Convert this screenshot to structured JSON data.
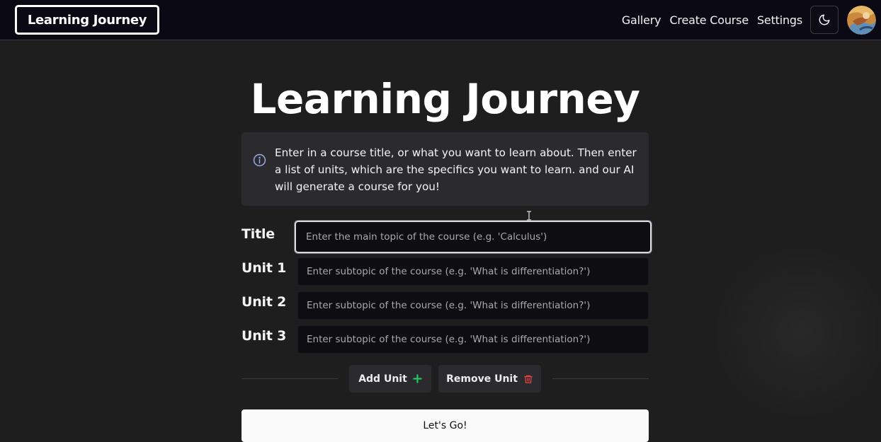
{
  "app": {
    "brand": "Learning Journey"
  },
  "nav": {
    "links": [
      "Gallery",
      "Create Course",
      "Settings"
    ],
    "theme_icon": "moon-icon",
    "avatar_icon": "user-avatar"
  },
  "main": {
    "title": "Learning Journey",
    "info": {
      "icon": "info-icon",
      "text": "Enter in a course title, or what you want to learn about. Then enter a list of units, which are the specifics you want to learn. and our AI will generate a course for you!"
    },
    "form": {
      "title_label": "Title",
      "title_placeholder": "Enter the main topic of the course (e.g. 'Calculus')",
      "title_value": "",
      "units": [
        {
          "label": "Unit 1",
          "placeholder": "Enter subtopic of the course (e.g. 'What is differentiation?')",
          "value": ""
        },
        {
          "label": "Unit 2",
          "placeholder": "Enter subtopic of the course (e.g. 'What is differentiation?')",
          "value": ""
        },
        {
          "label": "Unit 3",
          "placeholder": "Enter subtopic of the course (e.g. 'What is differentiation?')",
          "value": ""
        }
      ]
    },
    "actions": {
      "add_unit": "Add Unit",
      "add_icon": "plus-icon",
      "remove_unit": "Remove Unit",
      "remove_icon": "trash-icon",
      "submit": "Let's Go!"
    }
  },
  "colors": {
    "nav_bg": "#0b0a14",
    "page_bg": "#1f1e1f",
    "panel_bg": "#2b2b2f",
    "input_bg": "#0e0e12",
    "add_icon": "#22c55e",
    "remove_icon": "#ef4444",
    "info_icon": "#93a4d8",
    "submit_bg": "#fafafa"
  }
}
